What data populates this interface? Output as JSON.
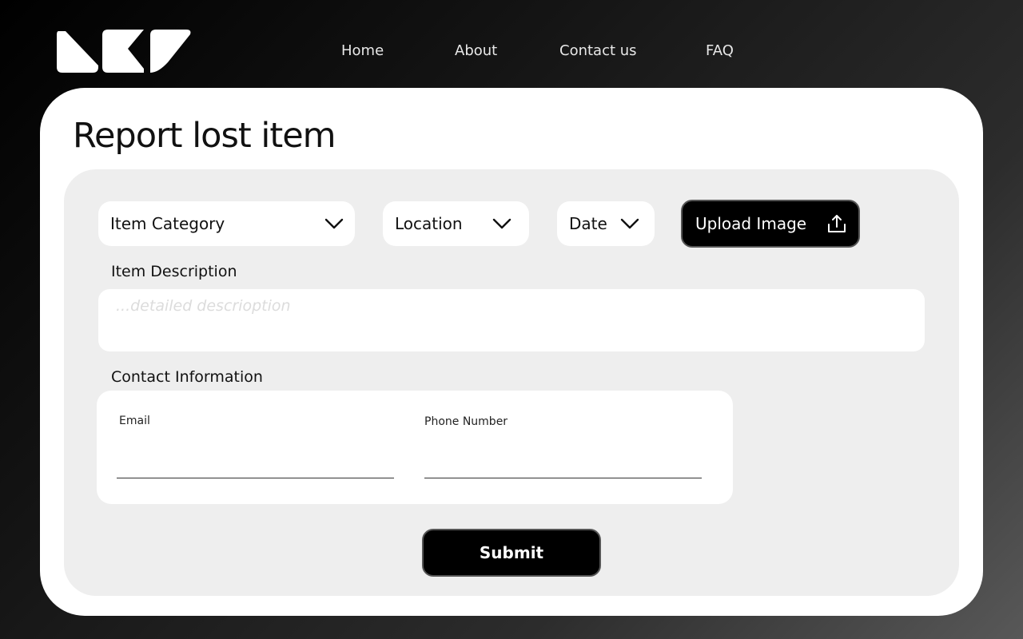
{
  "header": {
    "logo_icon": "brand-logo",
    "nav": {
      "home": "Home",
      "about": "About",
      "contact": "Contact us",
      "faq": "FAQ"
    }
  },
  "form": {
    "title": "Report lost item",
    "selects": {
      "category": "Item Category",
      "location": "Location",
      "date": "Date"
    },
    "upload": {
      "label": "Upload Image",
      "icon": "upload-icon"
    },
    "description": {
      "label": "Item Description",
      "placeholder": "...detailed descrioption",
      "value": ""
    },
    "contact": {
      "label": "Contact Information",
      "email_label": "Email",
      "email_value": "",
      "phone_label": "Phone Number",
      "phone_value": ""
    },
    "submit_label": "Submit"
  },
  "colors": {
    "card": "#ffffff",
    "panel": "#eeeeee",
    "button": "#000000",
    "text": "#111111"
  }
}
